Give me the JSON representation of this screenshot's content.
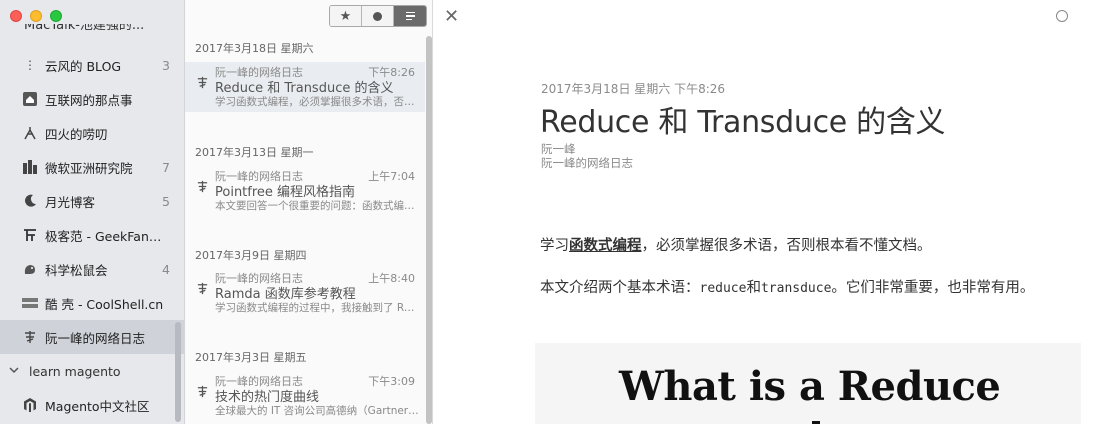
{
  "sidebar": {
    "partial_label": "MacTalk-池建强的...",
    "items": [
      {
        "label": "云风的 BLOG",
        "count": "3",
        "icon": "cloud-icon"
      },
      {
        "label": "互联网的那点事",
        "count": "",
        "icon": "home-icon"
      },
      {
        "label": "四火的唠叨",
        "count": "",
        "icon": "fire-icon"
      },
      {
        "label": "微软亚洲研究院",
        "count": "7",
        "icon": "msra-icon"
      },
      {
        "label": "月光博客",
        "count": "5",
        "icon": "moon-icon"
      },
      {
        "label": "极客范 - GeekFan....",
        "count": "",
        "icon": "geekfan-icon"
      },
      {
        "label": "科学松鼠会",
        "count": "4",
        "icon": "squirrel-icon"
      },
      {
        "label": "酷 壳 - CoolShell.cn",
        "count": "",
        "icon": "coolshell-icon"
      },
      {
        "label": "阮一峰的网络日志",
        "count": "",
        "icon": "ruanyf-icon"
      }
    ],
    "group": {
      "label": "learn magento"
    },
    "group_item": {
      "label": "Magento中文社区",
      "icon": "magento-icon"
    }
  },
  "list": {
    "filters": {
      "starred": "★",
      "unread": "●",
      "all": "≡"
    },
    "groups": [
      {
        "date": "2017年3月18日 星期六",
        "article": {
          "source": "阮一峰的网络日志",
          "time": "下午8:26",
          "title": "Reduce 和 Transduce 的含义",
          "snippet": "学习函数式编程，必须掌握很多术语，否则根本看不懂文档。"
        }
      },
      {
        "date": "2017年3月13日 星期一",
        "article": {
          "source": "阮一峰的网络日志",
          "time": "上午7:04",
          "title": "Pointfree 编程风格指南",
          "snippet": "本文要回答一个很重要的问题：函数式编程有什么用？"
        }
      },
      {
        "date": "2017年3月9日 星期四",
        "article": {
          "source": "阮一峰的网络日志",
          "time": "上午8:40",
          "title": "Ramda 函数库参考教程",
          "snippet": "学习函数式编程的过程中，我接触到了 Ramda.js。"
        }
      },
      {
        "date": "2017年3月3日 星期五",
        "article": {
          "source": "阮一峰的网络日志",
          "time": "下午3:09",
          "title": "技术的热门度曲线",
          "snippet": "全球最大的 IT 咨询公司高德纳（Gartner）有一张著名的曲线。"
        }
      }
    ]
  },
  "reader": {
    "date": "2017年3月18日 星期六 下午8:26",
    "title": "Reduce 和 Transduce 的含义",
    "author": "阮一峰",
    "feed": "阮一峰的网络日志",
    "p1_before": "学习",
    "p1_link": "函数式编程",
    "p1_after": "，必须掌握很多术语，否则根本看不懂文档。",
    "p2_a": "本文介绍两个基本术语：",
    "p2_code1": "reduce",
    "p2_b": "和",
    "p2_code2": "transduce",
    "p2_c": "。它们非常重要，也非常有用。",
    "figure_text": "What is a Reduce"
  },
  "colors": {
    "sidebar_bg": "#e6e8ec",
    "selected_bg": "#cfd3d9",
    "text": "#333333"
  }
}
